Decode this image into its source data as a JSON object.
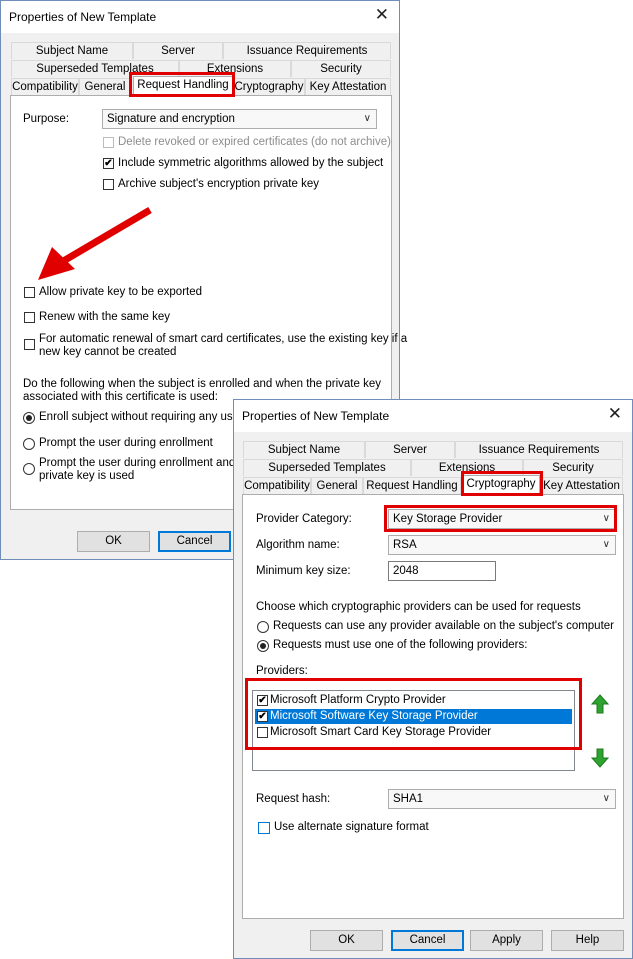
{
  "dialog1": {
    "title": "Properties of New Template",
    "close_glyph": "✕",
    "tabs_row1": [
      "Subject Name",
      "Server",
      "Issuance Requirements"
    ],
    "tabs_row2": [
      "Superseded Templates",
      "Extensions",
      "Security"
    ],
    "tabs_row3": [
      "Compatibility",
      "General",
      "Request Handling",
      "Cryptography",
      "Key Attestation"
    ],
    "purpose_label": "Purpose:",
    "purpose_value": "Signature and encryption",
    "delete_revoked": "Delete revoked or expired certificates (do not archive)",
    "include_symmetric": "Include symmetric algorithms allowed by the subject",
    "archive_key": "Archive subject's encryption private key",
    "allow_export": "Allow private key to be exported",
    "renew_same": "Renew with the same key",
    "auto_renew_line1": "For automatic renewal of smart card certificates, use the existing key if a",
    "auto_renew_line2": "new key cannot be created",
    "following_line1": "Do the following when the subject is enrolled and when the private key",
    "following_line2": "associated with this certificate is used:",
    "enroll_without": "Enroll subject without requiring any user in",
    "prompt_during": "Prompt the user during enrollment",
    "prompt_and_line1": "Prompt the user during enrollment and req",
    "prompt_and_line2": "private key is used",
    "ok": "OK",
    "cancel": "Cancel"
  },
  "dialog2": {
    "title": "Properties of New Template",
    "close_glyph": "✕",
    "tabs_row1": [
      "Subject Name",
      "Server",
      "Issuance Requirements"
    ],
    "tabs_row2": [
      "Superseded Templates",
      "Extensions",
      "Security"
    ],
    "tabs_row3": [
      "Compatibility",
      "General",
      "Request Handling",
      "Cryptography",
      "Key Attestation"
    ],
    "provider_category_label": "Provider Category:",
    "provider_category_value": "Key Storage Provider",
    "algorithm_label": "Algorithm name:",
    "algorithm_value": "RSA",
    "min_key_label": "Minimum key size:",
    "min_key_value": "2048",
    "choose_label": "Choose which cryptographic providers can be used for requests",
    "any_provider": "Requests can use any provider available on the subject's computer",
    "must_use": "Requests must use one of the following providers:",
    "providers_label": "Providers:",
    "providers": [
      {
        "name": "Microsoft Platform Crypto Provider",
        "checked": true,
        "selected": false
      },
      {
        "name": "Microsoft Software Key Storage Provider",
        "checked": true,
        "selected": true
      },
      {
        "name": "Microsoft Smart Card Key Storage Provider",
        "checked": false,
        "selected": false
      }
    ],
    "request_hash_label": "Request hash:",
    "request_hash_value": "SHA1",
    "alt_signature": "Use alternate signature format",
    "ok": "OK",
    "cancel": "Cancel",
    "apply": "Apply",
    "help": "Help"
  },
  "colors": {
    "highlight": "#e00000",
    "selection": "#0078d7",
    "arrow_green": "#2fa32f"
  },
  "icons": {
    "up": "green-up-arrow-icon",
    "down": "green-down-arrow-icon",
    "annotation": "red-arrow-icon"
  }
}
